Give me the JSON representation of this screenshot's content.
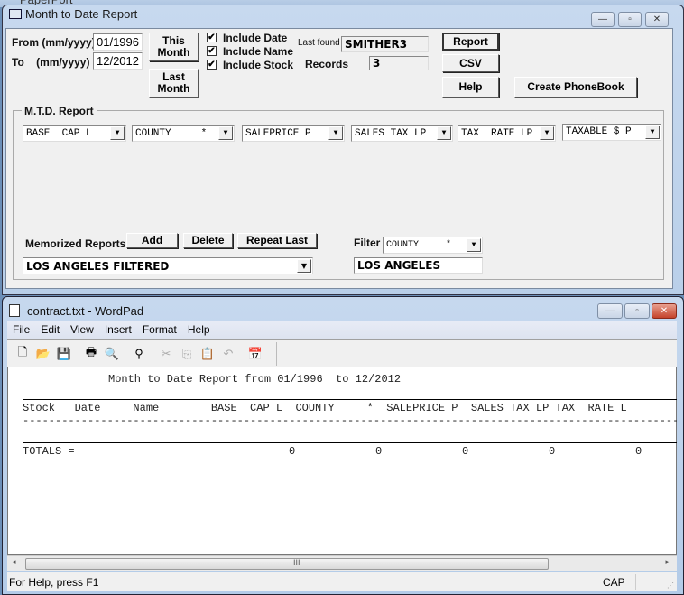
{
  "background_window": {
    "title": "PaperPort"
  },
  "mtd_window": {
    "title": "Month to Date Report",
    "from_label": "From (mm/yyyy)",
    "from_value": "01/1996",
    "to_label": "To    (mm/yyyy)",
    "to_value": "12/2012",
    "this_month_label": "This Month",
    "last_month_label": "Last Month",
    "checkboxes": [
      {
        "label": "Include Date",
        "checked": true,
        "mark": "✔"
      },
      {
        "label": "Include Name",
        "checked": true,
        "mark": "✔"
      },
      {
        "label": "Include Stock",
        "checked": true,
        "mark": "✔"
      }
    ],
    "last_found_label": "Last found",
    "last_found_value": "SMITHER3",
    "records_label": "Records",
    "records_value": "3",
    "report_label": "Report",
    "csv_label": "CSV",
    "help_label": "Help",
    "create_phonebook_label": "Create PhoneBook",
    "group_label": "M.T.D. Report",
    "columns": [
      "BASE  CAP L",
      "COUNTY     *",
      "SALEPRICE P",
      "SALES TAX LP",
      "TAX  RATE LP",
      "TAXABLE $ P"
    ],
    "memorized_label": "Memorized Reports",
    "add_label": "Add",
    "delete_label": "Delete",
    "repeat_last_label": "Repeat Last",
    "memorized_value": "LOS ANGELES FILTERED",
    "filter_label": "Filter",
    "filter_field": "COUNTY     *",
    "filter_value": "LOS ANGELES",
    "dropdown_glyph": "▼"
  },
  "wordpad": {
    "title": "contract.txt - WordPad",
    "menu": [
      "File",
      "Edit",
      "View",
      "Insert",
      "Format",
      "Help"
    ],
    "toolbar_icons": [
      "new-icon",
      "open-icon",
      "save-icon",
      "print-icon",
      "print-preview-icon",
      "find-icon",
      "cut-icon",
      "copy-icon",
      "paste-icon",
      "undo-icon",
      "date-time-icon"
    ],
    "document": {
      "heading": "Month to Date Report from 01/1996  to 12/2012",
      "header_row": "Stock   Date     Name        BASE  CAP L  COUNTY     *  SALEPRICE P  SALES TAX LP TAX  RATE L",
      "dash_row": "------------------------------------------------------------------------------------------------------------",
      "totals_label": "TOTALS =",
      "totals": [
        "0",
        "0",
        "0",
        "0",
        "0"
      ]
    },
    "status_text": "For Help, press F1",
    "status_cap": "CAP",
    "scroll_grip": "III"
  }
}
